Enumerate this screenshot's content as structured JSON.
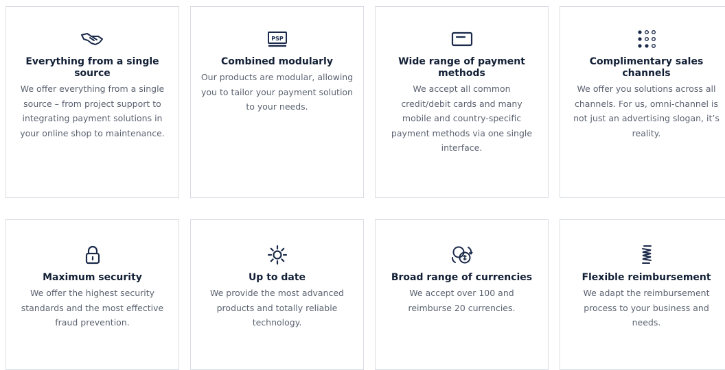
{
  "features": [
    {
      "icon": "handshake-icon",
      "title": "Everything from a single source",
      "description": "We offer everything from a single source – from project support to integrating payment solutions in your online shop to maintenance."
    },
    {
      "icon": "psp-terminal-icon",
      "icon_text": "PSP",
      "title": "Combined modularly",
      "description": "Our products are modular, allowing you to tailor your payment solution to your needs."
    },
    {
      "icon": "credit-card-icon",
      "title": "Wide range of payment methods",
      "description": "We accept all common credit/debit cards and many mobile and country-specific payment methods via one single interface."
    },
    {
      "icon": "dot-grid-icon",
      "title": "Complimentary sales channels",
      "description": "We offer you solutions across all channels. For us, omni-channel is not just an advertising slogan, it’s reality."
    },
    {
      "icon": "padlock-icon",
      "title": "Maximum security",
      "description": "We offer the highest security standards and the most effective fraud prevention."
    },
    {
      "icon": "sun-icon",
      "title": "Up to date",
      "description": "We provide the most advanced products and totally reliable technology."
    },
    {
      "icon": "currency-exchange-icon",
      "title": "Broad range of currencies",
      "description": "We accept over 100 and reimburse 20 currencies."
    },
    {
      "icon": "coil-spring-icon",
      "title": "Flexible reimbursement",
      "description": "We adapt the reimbursement process to your business and needs."
    }
  ],
  "colors": {
    "title": "#121f35",
    "text": "#5b6270",
    "icon": "#1b2a4a",
    "border": "#d9dde3"
  }
}
